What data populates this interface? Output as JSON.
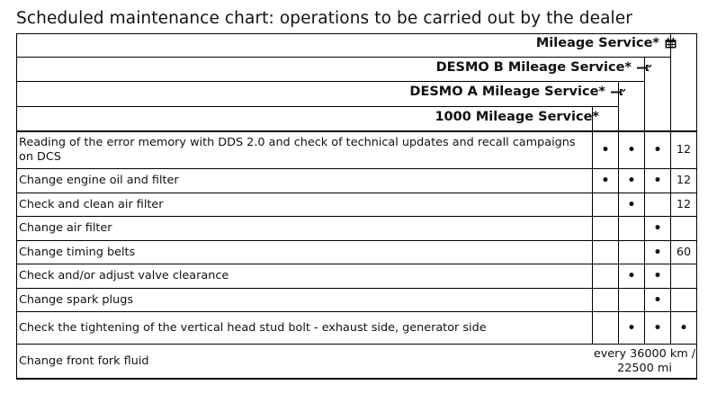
{
  "title": "Scheduled maintenance chart: operations to be carried out by the dealer",
  "headers": {
    "mileage_service": "Mileage Service*",
    "desmo_b": "DESMO B Mileage Service*",
    "desmo_a": "DESMO A Mileage Service*",
    "service_1000": "1000 Mileage Service*"
  },
  "icons": {
    "mileage_service": "calendar-icon",
    "desmo_b": "wrench-icon",
    "desmo_a": "wrench-icon"
  },
  "rows": [
    {
      "label": "Reading of the error memory with DDS 2.0 and check of technical updates and recall campaigns on DCS",
      "c1000": "•",
      "desmo_a": "•",
      "desmo_b": "•",
      "mileage": "12"
    },
    {
      "label": "Change engine oil and filter",
      "c1000": "•",
      "desmo_a": "•",
      "desmo_b": "•",
      "mileage": "12"
    },
    {
      "label": "Check and clean air filter",
      "c1000": "",
      "desmo_a": "•",
      "desmo_b": "",
      "mileage": "12"
    },
    {
      "label": "Change air filter",
      "c1000": "",
      "desmo_a": "",
      "desmo_b": "•",
      "mileage": ""
    },
    {
      "label": "Change timing belts",
      "c1000": "",
      "desmo_a": "",
      "desmo_b": "•",
      "mileage": "60"
    },
    {
      "label": "Check and/or adjust valve clearance",
      "c1000": "",
      "desmo_a": "•",
      "desmo_b": "•",
      "mileage": ""
    },
    {
      "label": "Change spark plugs",
      "c1000": "",
      "desmo_a": "",
      "desmo_b": "•",
      "mileage": ""
    },
    {
      "label": "Check the tightening of the vertical head stud bolt - exhaust side, generator side",
      "c1000": "",
      "desmo_a": "•",
      "desmo_b": "•",
      "mileage": "•"
    },
    {
      "label": "Change front fork fluid",
      "merged": "every 36000 km / 22500 mi"
    }
  ]
}
